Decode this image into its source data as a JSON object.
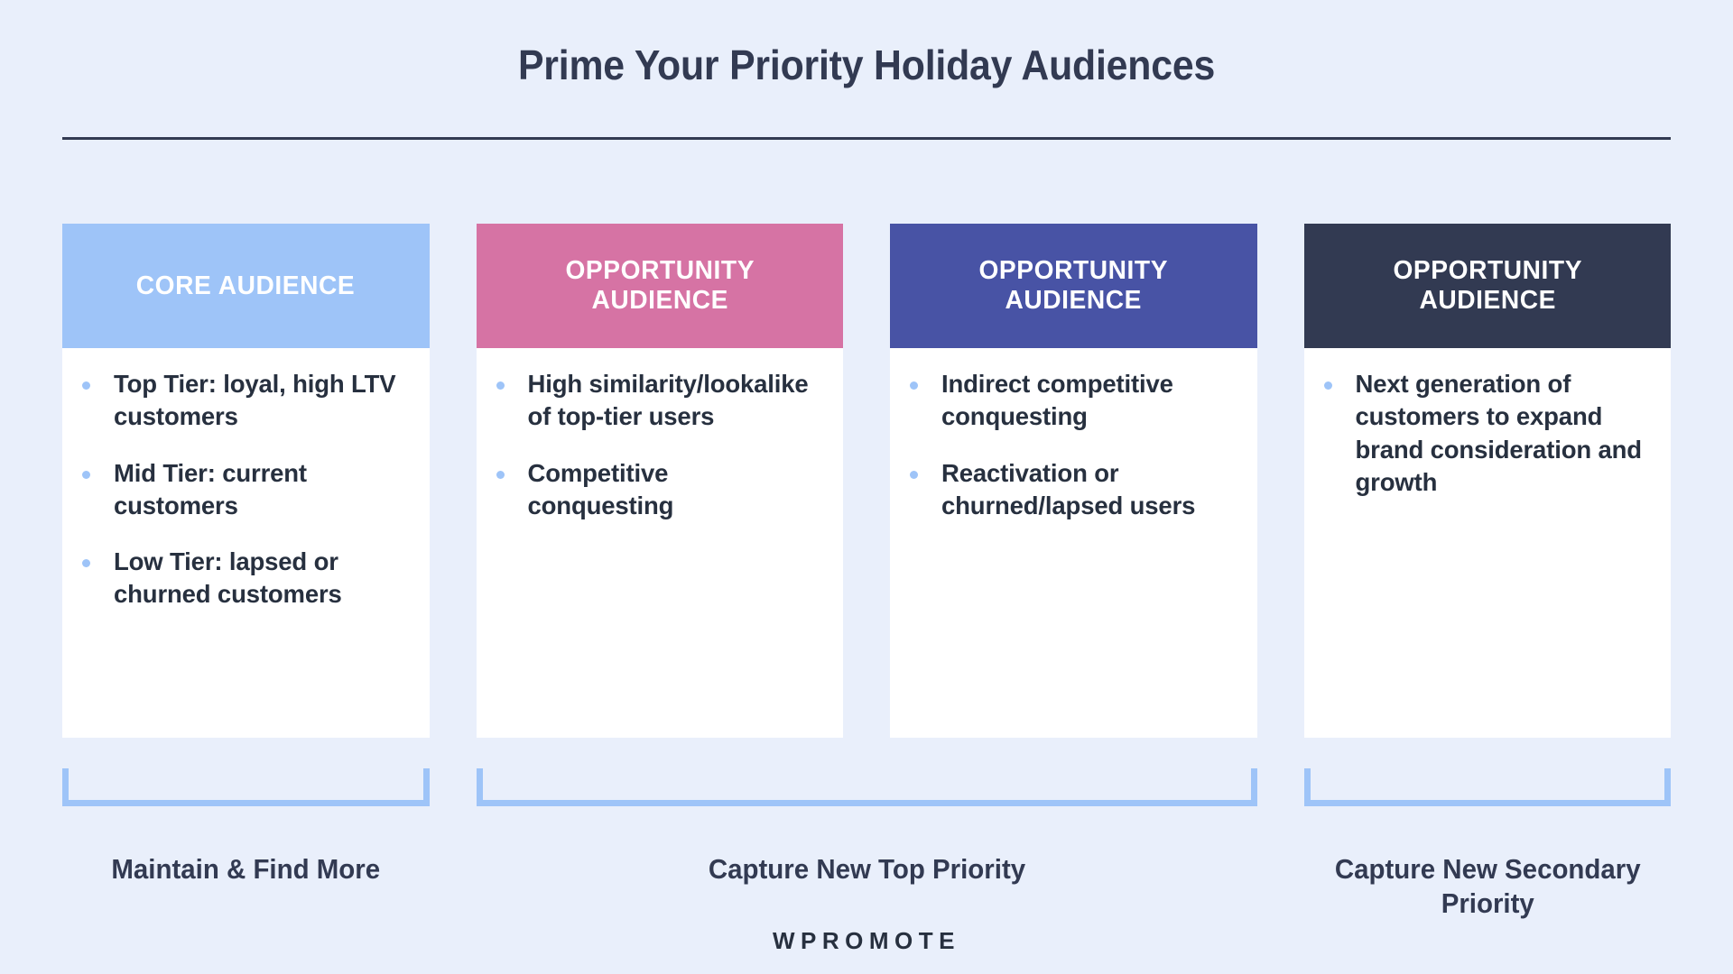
{
  "slide": {
    "title": "Prime Your Priority Holiday Audiences",
    "background_color": "#e9effb",
    "rule_color": "#323a52",
    "bullet_dot_color": "#9ec4f8",
    "bracket_color": "#9ec4f8",
    "body_text_color": "#27303f",
    "logo": "WPROMOTE"
  },
  "cards": [
    {
      "header": "CORE AUDIENCE",
      "header_color": "#9ec4f8",
      "bullets": [
        "Top Tier: loyal, high LTV customers",
        "Mid Tier: current customers",
        "Low Tier: lapsed or churned customers"
      ]
    },
    {
      "header": "OPPORTUNITY AUDIENCE",
      "header_color": "#d673a4",
      "bullets": [
        "High similarity/lookalike of top-tier users",
        "Competitive conquesting"
      ]
    },
    {
      "header": "OPPORTUNITY AUDIENCE",
      "header_color": "#4853a5",
      "bullets": [
        "Indirect competitive conquesting",
        "Reactivation or churned/lapsed users"
      ]
    },
    {
      "header": "OPPORTUNITY AUDIENCE",
      "header_color": "#323a52",
      "bullets": [
        "Next generation of customers to expand brand consideration and growth"
      ]
    }
  ],
  "groups": [
    {
      "label": "Maintain & Find More",
      "spans_cards": [
        0
      ]
    },
    {
      "label": "Capture New Top Priority",
      "spans_cards": [
        1,
        2
      ]
    },
    {
      "label": "Capture New Secondary Priority",
      "spans_cards": [
        3
      ]
    }
  ]
}
